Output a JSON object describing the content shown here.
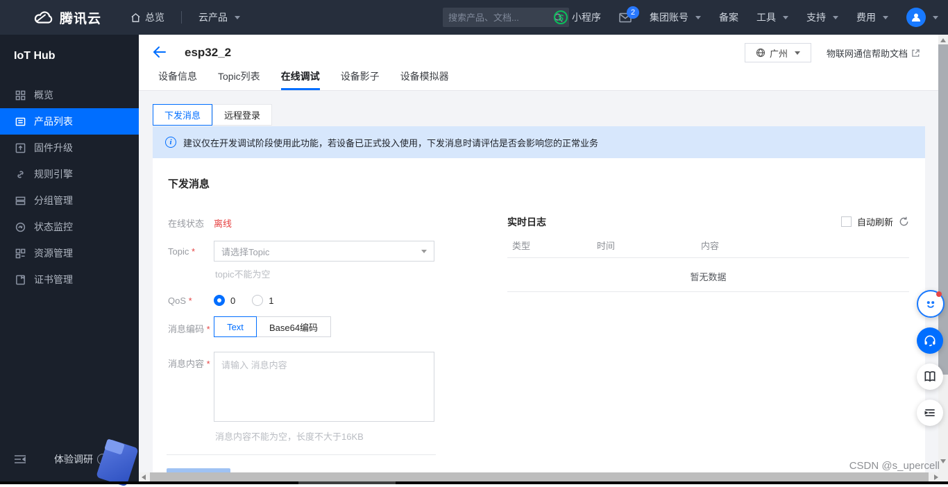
{
  "colors": {
    "accent": "#006eff",
    "offline_red": "#e64242",
    "navbar_bg": "#262e3c",
    "sidebar_bg": "#1a202b",
    "banner_bg": "#d7e7fc"
  },
  "navbar": {
    "brand": "腾讯云",
    "overview": "总览",
    "products_menu": "云产品",
    "search_placeholder": "搜索产品、文档...",
    "mini_program": "小程序",
    "mail_badge": "2",
    "group_account": "集团账号",
    "record": "备案",
    "tools": "工具",
    "support": "支持",
    "billing": "费用"
  },
  "sidebar": {
    "title": "IoT Hub",
    "items": [
      {
        "label": "概览",
        "selected": false
      },
      {
        "label": "产品列表",
        "selected": true
      },
      {
        "label": "固件升级",
        "selected": false
      },
      {
        "label": "规则引擎",
        "selected": false
      },
      {
        "label": "分组管理",
        "selected": false
      },
      {
        "label": "状态监控",
        "selected": false
      },
      {
        "label": "资源管理",
        "selected": false
      },
      {
        "label": "证书管理",
        "selected": false
      }
    ],
    "survey": "体验调研"
  },
  "header": {
    "title": "esp32_2",
    "region": "广州",
    "help_link": "物联网通信帮助文档",
    "tabs": [
      {
        "label": "设备信息",
        "active": false
      },
      {
        "label": "Topic列表",
        "active": false
      },
      {
        "label": "在线调试",
        "active": true
      },
      {
        "label": "设备影子",
        "active": false
      },
      {
        "label": "设备模拟器",
        "active": false
      }
    ]
  },
  "debug": {
    "subtabs": [
      {
        "label": "下发消息",
        "active": true
      },
      {
        "label": "远程登录",
        "active": false
      }
    ],
    "banner": "建议仅在开发调试阶段使用此功能，若设备已正式投入使用，下发消息时请评估是否会影响您的正常业务",
    "form": {
      "title": "下发消息",
      "online_status_label": "在线状态",
      "online_status_value": "离线",
      "topic_label": "Topic",
      "topic_placeholder": "请选择Topic",
      "topic_error": "topic不能为空",
      "qos_label": "QoS",
      "qos_options": [
        "0",
        "1"
      ],
      "encoding_label": "消息编码",
      "encoding_options": [
        "Text",
        "Base64编码"
      ],
      "content_label": "消息内容",
      "content_placeholder": "请输入 消息内容",
      "content_hint": "消息内容不能为空，长度不大于16KB"
    },
    "log": {
      "title": "实时日志",
      "auto_refresh_label": "自动刷新",
      "columns": [
        "类型",
        "时间",
        "内容"
      ],
      "empty_text": "暂无数据"
    }
  },
  "watermark": "CSDN @s_upercell"
}
